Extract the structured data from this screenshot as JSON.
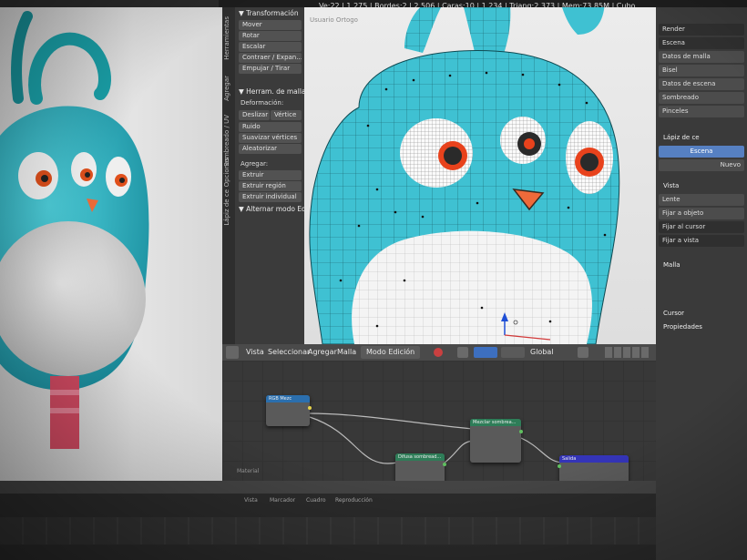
{
  "topbar": {
    "stats": "Ve:22 | 1.275 | Bordes:2 | 2.506 | Caras:10 | 1.234 | Triang:2.373 | Mem:73.85M | Cubo"
  },
  "tool_shelf": {
    "vertical_tabs": [
      "Herramientas",
      "Agregar",
      "Sombreado / UV",
      "Opciones",
      "Lápiz de ce"
    ],
    "transform_header": "▼ Transformación",
    "transform_buttons": [
      "Mover",
      "Rotar",
      "Escalar",
      "Contraer / Expan...",
      "Empujar / Tirar"
    ],
    "mesh_tools_header": "▼ Herram. de malla",
    "deform_label": "Deformación:",
    "deform_buttons": [
      "Deslizar",
      "Vértice",
      "Ruido",
      "Suavizar vértices",
      "Aleatorizar"
    ],
    "add_label": "Agregar:",
    "add_buttons": [
      "Extruir",
      "Extruir región",
      "Extruir individual"
    ],
    "toggle_edit_mode": "▼ Alternar modo Edición"
  },
  "viewport": {
    "view_label": "Usuario Ortogo",
    "body_color": "#3fc1d2",
    "belly_color": "#f4f4f4",
    "eye_ring_color": "#e8421c",
    "beak_color": "#ef6a3a"
  },
  "viewport_header": {
    "items": [
      "Vista",
      "Seleccionar",
      "Agregar",
      "Malla"
    ],
    "mode": "Modo Edición",
    "orientation": "Global"
  },
  "node_editor": {
    "nodes": [
      {
        "title": "RGB Mezc",
        "color": "#2b6fae"
      },
      {
        "title": "Mezclar sombrea...",
        "color": "#2e7d58"
      },
      {
        "title": "Difusa sombread...",
        "color": "#2e7d58"
      },
      {
        "title": "Salida",
        "color": "#3434b8"
      }
    ],
    "bottom_label": "Material"
  },
  "properties": {
    "rows": [
      "Render",
      "Escena",
      "Datos de malla",
      "Bisel",
      "Datos de escena",
      "Sombreado",
      "Pinceles",
      "Lápiz de ce",
      "Escena",
      "Nuevo",
      "Vista",
      "Lente",
      "Fijar a objeto",
      "Fijar al cursor",
      "Fijar a vista",
      "Malla",
      "Cursor",
      "Propiedades"
    ],
    "accent_color": "#5680c2"
  },
  "timeline": {
    "labels": [
      "Vista",
      "Marcador",
      "Cuadro",
      "Reproducción"
    ]
  }
}
